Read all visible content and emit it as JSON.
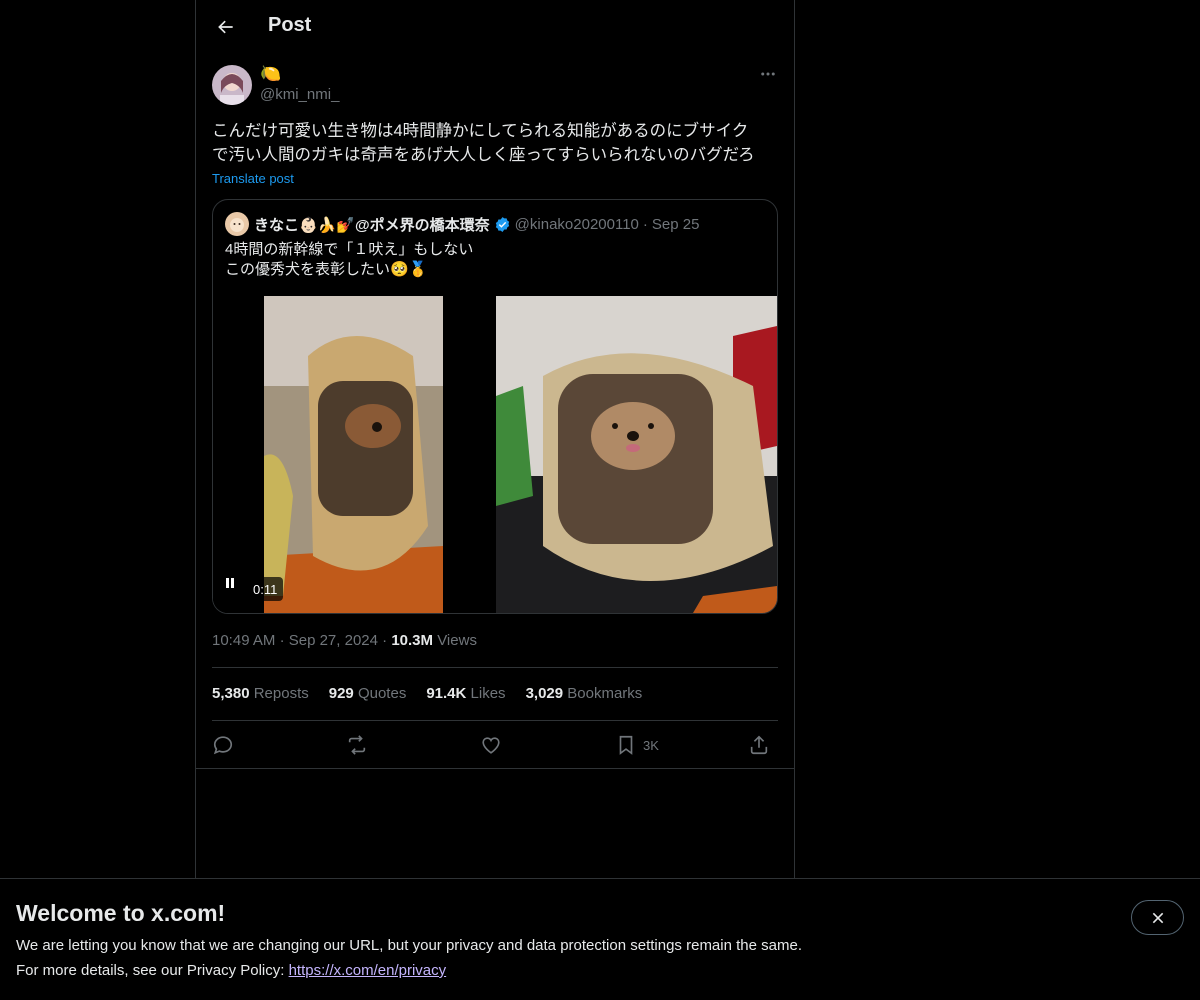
{
  "header": {
    "title": "Post"
  },
  "post": {
    "author": {
      "display_name": "🍋",
      "handle": "@kmi_nmi_"
    },
    "text_lines": [
      "こんだけ可愛い生き物は4時間静かにしてられる知能があるのにブサイク",
      "で汚い人間のガキは奇声をあげ大人しく座ってすらいられないのバグだろ"
    ],
    "translate_label": "Translate post",
    "quote": {
      "author_name": "きなこ👶🏻🍌💅@ポメ界の橋本環奈",
      "handle": "@kinako20200110",
      "separator": "·",
      "date": "Sep 25",
      "text_lines": [
        "4時間の新幹線で「１吠え」もしない",
        "この優秀犬を表彰したい🥺🥇"
      ],
      "video_time": "0:11"
    },
    "timestamp": "10:49 AM",
    "separator": "·",
    "date": "Sep 27, 2024",
    "views_count": "10.3M",
    "views_label": "Views",
    "stats": {
      "reposts": {
        "count": "5,380",
        "label": "Reposts"
      },
      "quotes": {
        "count": "929",
        "label": "Quotes"
      },
      "likes": {
        "count": "91.4K",
        "label": "Likes"
      },
      "bookmarks": {
        "count": "3,029",
        "label": "Bookmarks"
      }
    },
    "actions": {
      "bookmark_count": "3K"
    }
  },
  "banner": {
    "title": "Welcome to x.com!",
    "line1": "We are letting you know that we are changing our URL, but your privacy and data protection settings remain the same.",
    "line2_prefix": "For more details, see our Privacy Policy: ",
    "link": "https://x.com/en/privacy"
  },
  "colors": {
    "accent": "#1d9bf0",
    "muted": "#71767b",
    "border": "#2f3336",
    "background": "#000000"
  },
  "icons": [
    "back-arrow-icon",
    "more-icon",
    "verified-icon",
    "pause-icon",
    "reply-icon",
    "repost-icon",
    "like-icon",
    "bookmark-icon",
    "share-icon",
    "close-icon"
  ]
}
